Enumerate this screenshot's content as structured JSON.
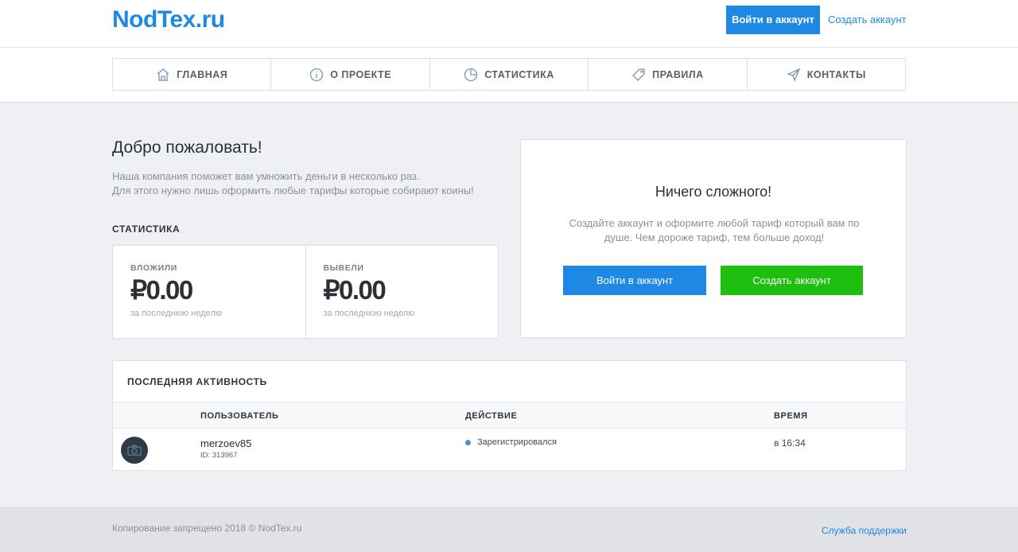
{
  "header": {
    "logo": "NodTex.ru",
    "login_label": "Войти в аккаунт",
    "register_label": "Создать аккаунт"
  },
  "nav": {
    "items": [
      {
        "label": "ГЛАВНАЯ",
        "icon": "home-icon"
      },
      {
        "label": "О ПРОЕКТЕ",
        "icon": "info-icon"
      },
      {
        "label": "СТАТИСТИКА",
        "icon": "pie-chart-icon"
      },
      {
        "label": "ПРАВИЛА",
        "icon": "tag-icon"
      },
      {
        "label": "КОНТАКТЫ",
        "icon": "send-icon"
      }
    ]
  },
  "welcome": {
    "title": "Добро пожаловать!",
    "line1": "Наша компания поможет вам умножить деньги в несколько раз.",
    "line2": "Для этого нужно лишь оформить любые тарифы которые собирают коины!"
  },
  "stats": {
    "heading": "СТАТИСТИКА",
    "invested": {
      "label": "ВЛОЖИЛИ",
      "value": "₽0.00",
      "sub": "за последнюю неделю"
    },
    "withdrawn": {
      "label": "ВЫВЕЛИ",
      "value": "₽0.00",
      "sub": "за последнюю неделю"
    }
  },
  "cta": {
    "title": "Ничего сложного!",
    "line1": "Создайте аккаунт и оформите любой тариф который вам по",
    "line2": "душе. Чем дороже тариф, тем больше доход!",
    "login_label": "Войти в аккаунт",
    "register_label": "Создать аккаунт"
  },
  "activity": {
    "title": "ПОСЛЕДНЯЯ АКТИВНОСТЬ",
    "columns": {
      "user": "ПОЛЬЗОВАТЕЛЬ",
      "action": "ДЕЙСТВИЕ",
      "time": "ВРЕМЯ"
    },
    "rows": [
      {
        "username": "merzoev85",
        "id": "ID: 313967",
        "action": "Зарегистрировался",
        "time": "в 16:34"
      }
    ]
  },
  "footer": {
    "copyright": "Копирование запрещено 2018 © NodTex.ru",
    "support": "Служба поддержки"
  },
  "colors": {
    "accent": "#1e88e5",
    "success": "#1fbf0f",
    "background": "#eff0f4"
  }
}
